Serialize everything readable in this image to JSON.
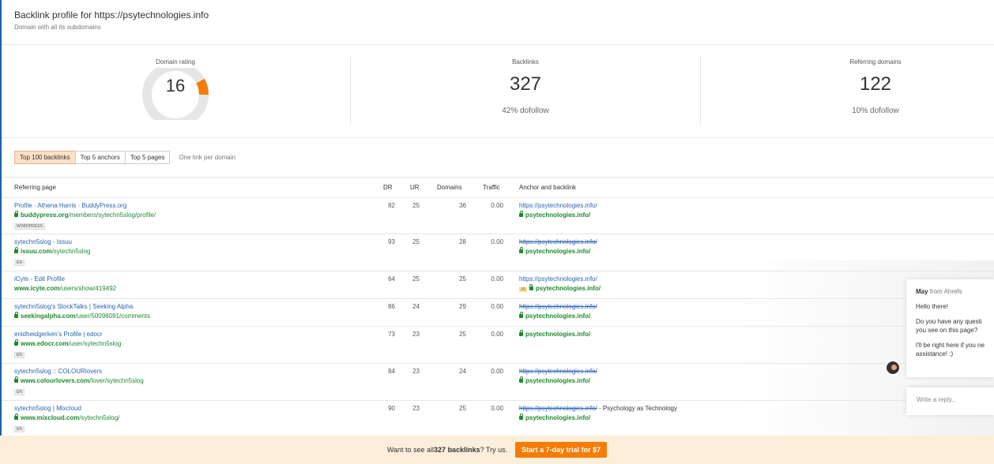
{
  "header": {
    "title": "Backlink profile for https://psytechnologies.info",
    "subtitle": "Domain with all its subdomains"
  },
  "stats": {
    "domain_rating": {
      "label": "Domain rating",
      "value": "16",
      "level": 0.16
    },
    "backlinks": {
      "label": "Backlinks",
      "value": "327",
      "note": "42% dofollow"
    },
    "referring_domains": {
      "label": "Referring domains",
      "value": "122",
      "note": "10% dofollow"
    }
  },
  "colors": {
    "accent": "#f57c00",
    "link": "#2a64b0",
    "url": "#1e8a2e",
    "footer_bg": "#fbeedb"
  },
  "tabs": [
    {
      "label": "Top 100 backlinks",
      "active": true
    },
    {
      "label": "Top 5 anchors",
      "active": false
    },
    {
      "label": "Top 5 pages",
      "active": false
    }
  ],
  "tab_note": "One link per domain",
  "table": {
    "headers": {
      "page": "Referring page",
      "dr": "DR",
      "ur": "UR",
      "domains": "Domains",
      "traffic": "Traffic",
      "anchor": "Anchor and backlink"
    },
    "rows": [
      {
        "title": "Profile · Athena Harris · BuddyPress.org",
        "domain": "buddypress.org",
        "path": "/members/sytechn5slog/profile/",
        "badge": "WORDPRESS",
        "dr": "82",
        "ur": "25",
        "domains": "36",
        "traffic": "0.00",
        "anchor_text": "https://psytechnologies.info/",
        "anchor_struck": false,
        "backlink": "psytechnologies.info/",
        "js": false,
        "extra": ""
      },
      {
        "title": "sytechn5slog - Issuu",
        "domain": "issuu.com",
        "path": "/sytechn5slog",
        "badge": "EN",
        "dr": "93",
        "ur": "25",
        "domains": "28",
        "traffic": "0.00",
        "anchor_text": "https://psytechnologies.info/",
        "anchor_struck": true,
        "backlink": "psytechnologies.info/",
        "js": false,
        "extra": ""
      },
      {
        "title": "iCyte - Edit Profile",
        "domain": "www.icyte.com",
        "path": "/users/show/419492",
        "badge": "",
        "dr": "64",
        "ur": "25",
        "domains": "25",
        "traffic": "0.00",
        "anchor_text": "https://psytechnologies.info/",
        "anchor_struck": false,
        "backlink": "psytechnologies.info/",
        "js": true,
        "extra": ""
      },
      {
        "title": "sytechn5slog's StockTalks | Seeking Alpha",
        "domain": "seekingalpha.com",
        "path": "/user/50098091/comments",
        "badge": "",
        "dr": "86",
        "ur": "24",
        "domains": "29",
        "traffic": "0.00",
        "anchor_text": "https://psytechnologies.info/",
        "anchor_struck": true,
        "backlink": "psytechnologies.info/",
        "js": false,
        "extra": ""
      },
      {
        "title": "enidheidgerken's Profile | edocr",
        "domain": "www.edocr.com",
        "path": "/user/sytechn5slog",
        "badge": "EN",
        "dr": "73",
        "ur": "23",
        "domains": "25",
        "traffic": "0.00",
        "anchor_text": "",
        "anchor_struck": false,
        "backlink": "psytechnologies.info/",
        "js": false,
        "extra": ""
      },
      {
        "title": "sytechn5slog :: COLOURlovers",
        "domain": "www.colourlovers.com",
        "path": "/lover/sytechn5slog",
        "badge": "EN",
        "dr": "84",
        "ur": "23",
        "domains": "24",
        "traffic": "0.00",
        "anchor_text": "https://psytechnologies.info/",
        "anchor_struck": true,
        "backlink": "psytechnologies.info/",
        "js": false,
        "extra": ""
      },
      {
        "title": "sytechn5slog | Mixcloud",
        "domain": "www.mixcloud.com",
        "path": "/sytechn5slog/",
        "badge": "EN",
        "dr": "90",
        "ur": "23",
        "domains": "25",
        "traffic": "0.00",
        "anchor_text": "https://psytechnologies.info/",
        "anchor_struck": true,
        "backlink": "psytechnologies.info/",
        "js": false,
        "extra": " - Psychology as Technology"
      }
    ]
  },
  "chat": {
    "sender_name": "May",
    "sender_org": " from Ahrefs",
    "greeting": "Hello there!",
    "question": "Do you have any questi",
    "question2": "you see on this page?",
    "followup": "I'll be right here if you ne",
    "followup2": "assistance! :)",
    "reply_placeholder": "Write a reply..."
  },
  "footer": {
    "text_before": "Want to see all ",
    "count": "327 backlinks",
    "text_after": "? Try us.",
    "cta": "Start a 7-day trial for $7"
  }
}
